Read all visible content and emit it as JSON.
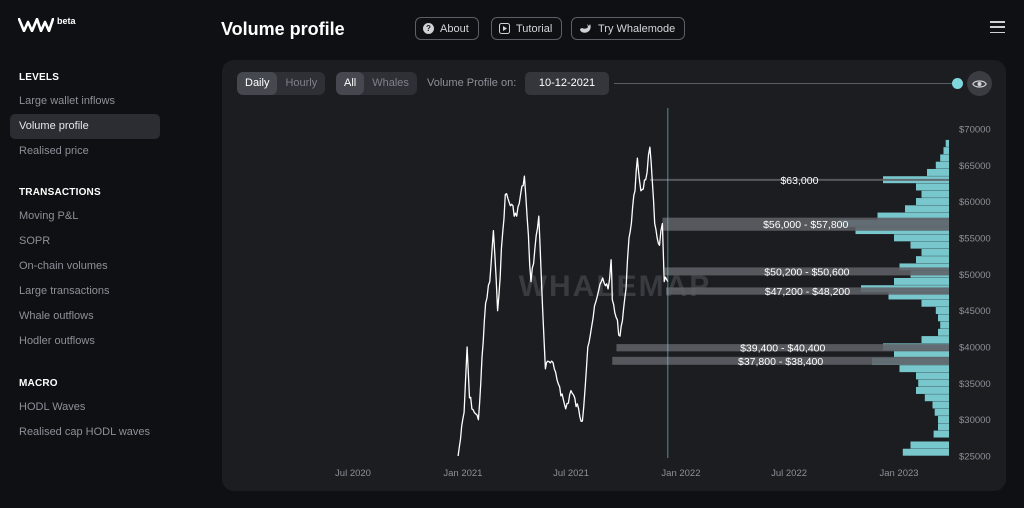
{
  "app": {
    "beta_badge": "beta",
    "page_title": "Volume profile"
  },
  "header": {
    "about_label": "About",
    "tutorial_label": "Tutorial",
    "whalemode_label": "Try Whalemode"
  },
  "sidebar": {
    "sections": [
      {
        "heading": "LEVELS",
        "items": [
          "Large wallet inflows",
          "Volume profile",
          "Realised price"
        ]
      },
      {
        "heading": "TRANSACTIONS",
        "items": [
          "Moving P&L",
          "SOPR",
          "On-chain volumes",
          "Large transactions",
          "Whale outflows",
          "Hodler outflows"
        ]
      },
      {
        "heading": "MACRO",
        "items": [
          "HODL Waves",
          "Realised cap HODL waves"
        ]
      }
    ],
    "active_item": "Volume profile"
  },
  "controls": {
    "interval_options": [
      "Daily",
      "Hourly"
    ],
    "interval_selected": "Daily",
    "cohort_options": [
      "All",
      "Whales"
    ],
    "cohort_selected": "All",
    "volume_profile_on_label": "Volume Profile on:",
    "date_value": "10-12-2021"
  },
  "colors": {
    "accent": "#7fd6dc",
    "price_line": "#ffffff",
    "level_band": "#5f6166",
    "panel_bg": "#1c1d21",
    "page_bg": "#0f1013"
  },
  "icons": {
    "about": "question-circle-icon",
    "tutorial": "play-icon",
    "whalemode": "whale-icon",
    "toggle": "eye-icon",
    "menu": "hamburger-menu-icon"
  },
  "chart_data": {
    "type": "line",
    "watermark": "WHALEMAP",
    "x_ticks": [
      "Jul 2020",
      "Jan 2021",
      "Jul 2021",
      "Jan 2022",
      "Jul 2022",
      "Jan 2023"
    ],
    "y_ticks": [
      "$70000",
      "$65000",
      "$60000",
      "$55000",
      "$50000",
      "$45000",
      "$40000",
      "$35000",
      "$30000",
      "$25000"
    ],
    "ylim": [
      25000,
      70000
    ],
    "cursor_date": "2021-12-10",
    "series": [
      {
        "x": [
          "2020-12-24",
          "2021-01-03",
          "2021-01-08",
          "2021-01-12",
          "2021-01-20",
          "2021-01-27",
          "2021-02-08",
          "2021-02-15",
          "2021-02-21",
          "2021-02-28",
          "2021-03-13",
          "2021-04-01",
          "2021-04-14",
          "2021-04-25",
          "2021-05-08",
          "2021-05-12",
          "2021-05-19",
          "2021-05-25",
          "2021-06-03",
          "2021-06-12",
          "2021-06-22",
          "2021-07-01",
          "2021-07-20",
          "2021-07-29",
          "2021-08-07",
          "2021-08-14",
          "2021-08-23",
          "2021-09-01",
          "2021-09-06",
          "2021-09-08",
          "2021-09-21",
          "2021-10-01",
          "2021-10-06",
          "2021-10-16",
          "2021-10-20",
          "2021-10-26",
          "2021-11-03",
          "2021-11-10",
          "2021-11-18",
          "2021-11-26",
          "2021-12-01",
          "2021-12-04",
          "2021-12-10"
        ],
        "values": [
          25000,
          31000,
          40000,
          33000,
          31000,
          30000,
          46000,
          49000,
          56000,
          45000,
          61000,
          58000,
          63500,
          49000,
          58000,
          50000,
          37000,
          38000,
          37000,
          34500,
          31500,
          34000,
          29800,
          40000,
          44000,
          47000,
          49500,
          48000,
          52000,
          46500,
          41500,
          48000,
          55000,
          61500,
          66000,
          61500,
          63000,
          67500,
          57000,
          54000,
          57000,
          49000,
          49000
        ]
      }
    ],
    "levels": [
      {
        "label": "$63,000",
        "low": 62700,
        "high": 63300
      },
      {
        "label": "$56,000 - $57,800",
        "low": 56000,
        "high": 57800
      },
      {
        "label": "$50,200 - $50,600",
        "low": 50200,
        "high": 50600
      },
      {
        "label": "$47,200 - $48,200",
        "low": 47200,
        "high": 48200
      },
      {
        "label": "$39,400 - $40,400",
        "low": 39400,
        "high": 40400
      },
      {
        "label": "$37,800 - $38,400",
        "low": 37800,
        "high": 38400
      }
    ],
    "profile": [
      {
        "price": 25500,
        "volume": 0.42
      },
      {
        "price": 26500,
        "volume": 0.35
      },
      {
        "price": 28000,
        "volume": 0.14
      },
      {
        "price": 29000,
        "volume": 0.1
      },
      {
        "price": 30000,
        "volume": 0.1
      },
      {
        "price": 31000,
        "volume": 0.13
      },
      {
        "price": 32000,
        "volume": 0.15
      },
      {
        "price": 33000,
        "volume": 0.22
      },
      {
        "price": 34000,
        "volume": 0.3
      },
      {
        "price": 35000,
        "volume": 0.28
      },
      {
        "price": 36000,
        "volume": 0.3
      },
      {
        "price": 37000,
        "volume": 0.45
      },
      {
        "price": 38000,
        "volume": 0.7
      },
      {
        "price": 39000,
        "volume": 0.5
      },
      {
        "price": 40000,
        "volume": 0.6
      },
      {
        "price": 41000,
        "volume": 0.25
      },
      {
        "price": 42000,
        "volume": 0.1
      },
      {
        "price": 43000,
        "volume": 0.08
      },
      {
        "price": 44000,
        "volume": 0.1
      },
      {
        "price": 45000,
        "volume": 0.12
      },
      {
        "price": 46000,
        "volume": 0.25
      },
      {
        "price": 47000,
        "volume": 0.55
      },
      {
        "price": 48000,
        "volume": 0.8
      },
      {
        "price": 49000,
        "volume": 0.5
      },
      {
        "price": 50000,
        "volume": 0.35
      },
      {
        "price": 51000,
        "volume": 0.45
      },
      {
        "price": 52000,
        "volume": 0.3
      },
      {
        "price": 53000,
        "volume": 0.25
      },
      {
        "price": 54000,
        "volume": 0.35
      },
      {
        "price": 55000,
        "volume": 0.5
      },
      {
        "price": 56000,
        "volume": 0.85
      },
      {
        "price": 57000,
        "volume": 1.0
      },
      {
        "price": 58000,
        "volume": 0.65
      },
      {
        "price": 59000,
        "volume": 0.4
      },
      {
        "price": 60000,
        "volume": 0.3
      },
      {
        "price": 61000,
        "volume": 0.25
      },
      {
        "price": 62000,
        "volume": 0.3
      },
      {
        "price": 63000,
        "volume": 0.6
      },
      {
        "price": 64000,
        "volume": 0.2
      },
      {
        "price": 65000,
        "volume": 0.12
      },
      {
        "price": 66000,
        "volume": 0.08
      },
      {
        "price": 67000,
        "volume": 0.05
      },
      {
        "price": 68000,
        "volume": 0.03
      }
    ]
  }
}
